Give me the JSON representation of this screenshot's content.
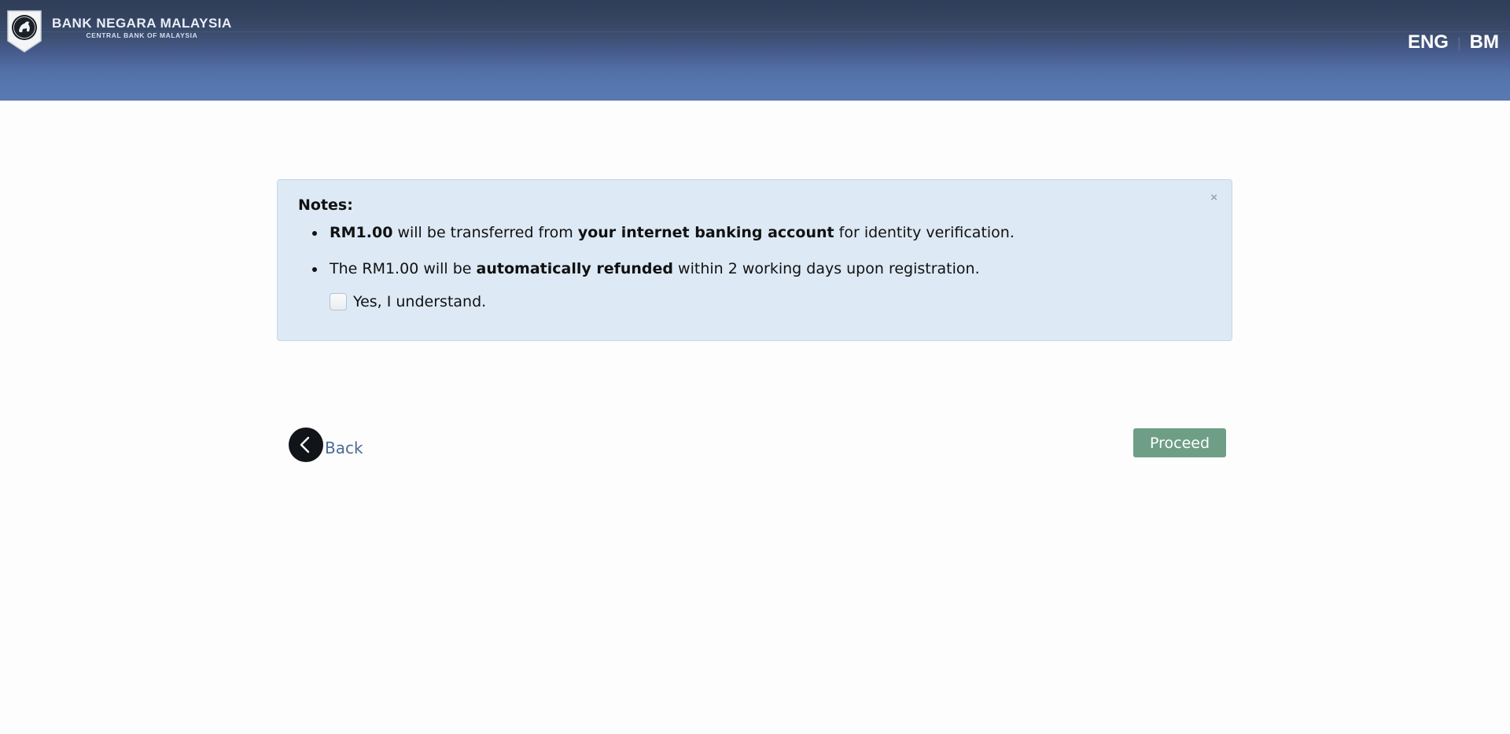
{
  "header": {
    "logo_title": "BANK NEGARA MALAYSIA",
    "logo_subtitle": "CENTRAL BANK OF MALAYSIA",
    "languages": {
      "eng": "ENG",
      "separator": "|",
      "bm": "BM"
    }
  },
  "notes": {
    "close_symbol": "×",
    "title": "Notes:",
    "item1": {
      "amount": "RM1.00",
      "text_a": " will be transferred from ",
      "account": "your internet banking account",
      "text_b": " for identity verification."
    },
    "item2": {
      "text_a": "The RM1.00 will be ",
      "refund": "automatically refunded",
      "text_b": " within 2 working days upon registration."
    },
    "confirm_label": "Yes, I understand.",
    "confirm_checked": false
  },
  "actions": {
    "back_label": "Back",
    "proceed_label": "Proceed"
  },
  "colors": {
    "header_top": "#2f3d58",
    "header_bottom": "#5878b1",
    "notes_bg": "#dde9f4",
    "proceed_bg": "#6e9e86",
    "back_link": "#4b6a96"
  }
}
